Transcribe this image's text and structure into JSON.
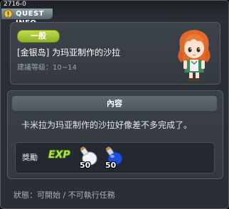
{
  "window": {
    "quest_id": "2716-0",
    "title": "QUEST INFO"
  },
  "quest": {
    "category": "一般",
    "name": "[金银岛] 为玛亚制作的沙拉",
    "level": "建議等級：10~14"
  },
  "content": {
    "header": "內容",
    "description": "卡米拉为玛亚制作的沙拉好像差不多完成了。"
  },
  "rewards": {
    "label": "獎勵",
    "exp_text": "EXP",
    "items": [
      {
        "icon": "white-potion-icon",
        "count": "50"
      },
      {
        "icon": "blue-potion-icon",
        "count": "50"
      }
    ]
  },
  "status": "狀態：可開始 / 不可執行任務",
  "colors": {
    "category_badge": "#9fc232",
    "background": "#2a2f36"
  }
}
